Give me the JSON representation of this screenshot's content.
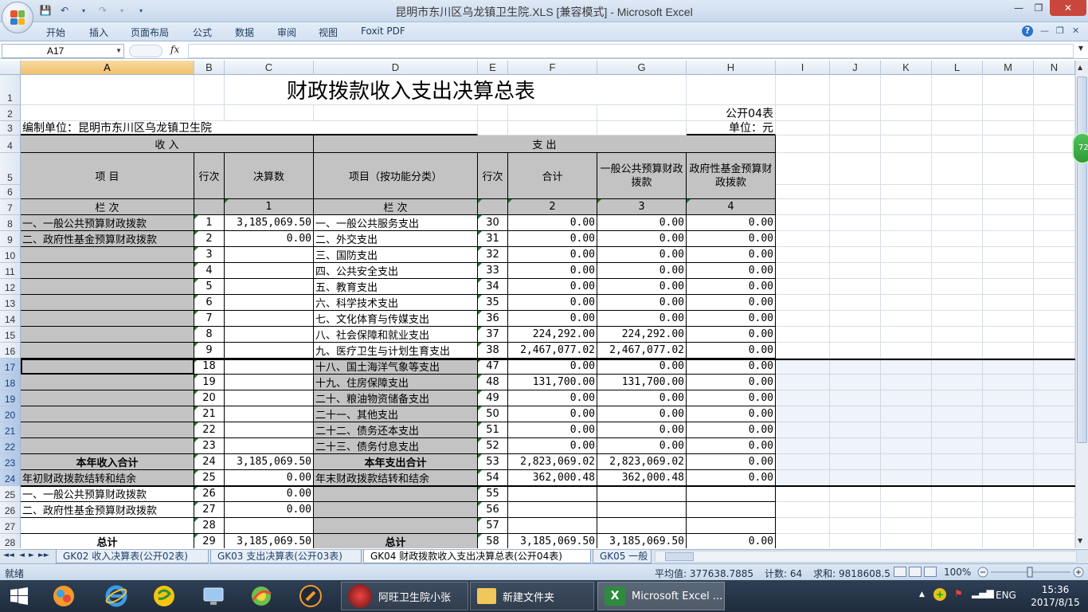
{
  "window": {
    "title": "昆明市东川区乌龙镇卫生院.XLS  [兼容模式] - Microsoft Excel",
    "controls": {
      "minimize": "—",
      "maximize": "❐",
      "close": "✕"
    }
  },
  "ribbon": {
    "tabs": [
      "开始",
      "插入",
      "页面布局",
      "公式",
      "数据",
      "审阅",
      "视图",
      "Foxit PDF"
    ],
    "help": "?"
  },
  "formula_bar": {
    "name_box": "A17",
    "fx_label": "fx",
    "content": ""
  },
  "columns": [
    "A",
    "B",
    "C",
    "D",
    "E",
    "F",
    "G",
    "H",
    "I",
    "J",
    "K",
    "L",
    "M",
    "N"
  ],
  "rows": [
    "1",
    "2",
    "3",
    "4",
    "5",
    "6",
    "7",
    "8",
    "9",
    "10",
    "11",
    "12",
    "13",
    "14",
    "15",
    "16",
    "17",
    "18",
    "19",
    "20",
    "21",
    "22",
    "23",
    "24",
    "25",
    "26",
    "27",
    "28"
  ],
  "report": {
    "title": "财政拨款收入支出决算总表",
    "form_no": "公开04表",
    "unit_label": "编制单位：昆明市东川区乌龙镇卫生院",
    "currency": "单位：元",
    "income_header": "收        入",
    "expense_header": "支        出",
    "col_item": "项        目",
    "col_line": "行次",
    "col_amount": "决算数",
    "col_func": "项目（按功能分类）",
    "col_line2": "行次",
    "col_total": "合计",
    "col_general": "一般公共预算财政拨款",
    "col_fund": "政府性基金预算财政拨款",
    "lanci": "栏        次",
    "lanci2": "栏        次",
    "col_no": {
      "c": "1",
      "f": "2",
      "g": "3",
      "h": "4"
    }
  },
  "table_rows": [
    {
      "a": "一、一般公共预算财政拨款",
      "b": "1",
      "c": "3,185,069.50",
      "d": "一、一般公共服务支出",
      "e": "30",
      "f": "0.00",
      "g": "0.00",
      "h": "0.00"
    },
    {
      "a": "二、政府性基金预算财政拨款",
      "b": "2",
      "c": "0.00",
      "d": "二、外交支出",
      "e": "31",
      "f": "0.00",
      "g": "0.00",
      "h": "0.00"
    },
    {
      "a": "",
      "b": "3",
      "c": "",
      "d": "三、国防支出",
      "e": "32",
      "f": "0.00",
      "g": "0.00",
      "h": "0.00"
    },
    {
      "a": "",
      "b": "4",
      "c": "",
      "d": "四、公共安全支出",
      "e": "33",
      "f": "0.00",
      "g": "0.00",
      "h": "0.00"
    },
    {
      "a": "",
      "b": "5",
      "c": "",
      "d": "五、教育支出",
      "e": "34",
      "f": "0.00",
      "g": "0.00",
      "h": "0.00"
    },
    {
      "a": "",
      "b": "6",
      "c": "",
      "d": "六、科学技术支出",
      "e": "35",
      "f": "0.00",
      "g": "0.00",
      "h": "0.00"
    },
    {
      "a": "",
      "b": "7",
      "c": "",
      "d": "七、文化体育与传媒支出",
      "e": "36",
      "f": "0.00",
      "g": "0.00",
      "h": "0.00"
    },
    {
      "a": "",
      "b": "8",
      "c": "",
      "d": "八、社会保障和就业支出",
      "e": "37",
      "f": "224,292.00",
      "g": "224,292.00",
      "h": "0.00"
    },
    {
      "a": "",
      "b": "9",
      "c": "",
      "d": "九、医疗卫生与计划生育支出",
      "e": "38",
      "f": "2,467,077.02",
      "g": "2,467,077.02",
      "h": "0.00"
    },
    {
      "a": "",
      "b": "18",
      "c": "",
      "d": "十八、国土海洋气象等支出",
      "e": "47",
      "f": "0.00",
      "g": "0.00",
      "h": "0.00"
    },
    {
      "a": "",
      "b": "19",
      "c": "",
      "d": "十九、住房保障支出",
      "e": "48",
      "f": "131,700.00",
      "g": "131,700.00",
      "h": "0.00"
    },
    {
      "a": "",
      "b": "20",
      "c": "",
      "d": "二十、粮油物资储备支出",
      "e": "49",
      "f": "0.00",
      "g": "0.00",
      "h": "0.00"
    },
    {
      "a": "",
      "b": "21",
      "c": "",
      "d": "二十一、其他支出",
      "e": "50",
      "f": "0.00",
      "g": "0.00",
      "h": "0.00"
    },
    {
      "a": "",
      "b": "22",
      "c": "",
      "d": "二十二、债务还本支出",
      "e": "51",
      "f": "0.00",
      "g": "0.00",
      "h": "0.00"
    },
    {
      "a": "",
      "b": "23",
      "c": "",
      "d": "二十三、债务付息支出",
      "e": "52",
      "f": "0.00",
      "g": "0.00",
      "h": "0.00"
    },
    {
      "a": "本年收入合计",
      "b": "24",
      "c": "3,185,069.50",
      "d": "本年支出合计",
      "e": "53",
      "f": "2,823,069.02",
      "g": "2,823,069.02",
      "h": "0.00"
    },
    {
      "a": "年初财政拨款结转和结余",
      "b": "25",
      "c": "0.00",
      "d": "年末财政拨款结转和结余",
      "e": "54",
      "f": "362,000.48",
      "g": "362,000.48",
      "h": "0.00"
    },
    {
      "a": "一、一般公共预算财政拨款",
      "b": "26",
      "c": "0.00",
      "d": "",
      "e": "55",
      "f": "",
      "g": "",
      "h": ""
    },
    {
      "a": "二、政府性基金预算财政拨款",
      "b": "27",
      "c": "0.00",
      "d": "",
      "e": "56",
      "f": "",
      "g": "",
      "h": ""
    },
    {
      "a": "",
      "b": "28",
      "c": "",
      "d": "",
      "e": "57",
      "f": "",
      "g": "",
      "h": ""
    },
    {
      "a": "总计",
      "b": "29",
      "c": "3,185,069.50",
      "d": "总计",
      "e": "58",
      "f": "3,185,069.50",
      "g": "3,185,069.50",
      "h": "0.00"
    }
  ],
  "sheet_tabs": [
    "GK02 收入决算表(公开02表)",
    "GK03 支出决算表(公开03表)",
    "GK04 财政拨款收入支出决算总表(公开04表)",
    "GK05 一般"
  ],
  "active_sheet_index": 2,
  "status": {
    "ready": "就绪",
    "average": "平均值: 377638.7885",
    "count": "计数: 64",
    "sum": "求和: 9818608.5",
    "zoom": "100%"
  },
  "side_badge": "72",
  "taskbar": {
    "tasks": [
      "阿旺卫生院小张",
      "新建文件夹",
      "Microsoft Excel ..."
    ],
    "lang": "ENG",
    "time": "15:36",
    "date": "2017/8/15"
  },
  "colors": {
    "accent": "#1d7a2d",
    "header_gray": "#c3c3c3",
    "taskbar": "#1f2c3d"
  }
}
